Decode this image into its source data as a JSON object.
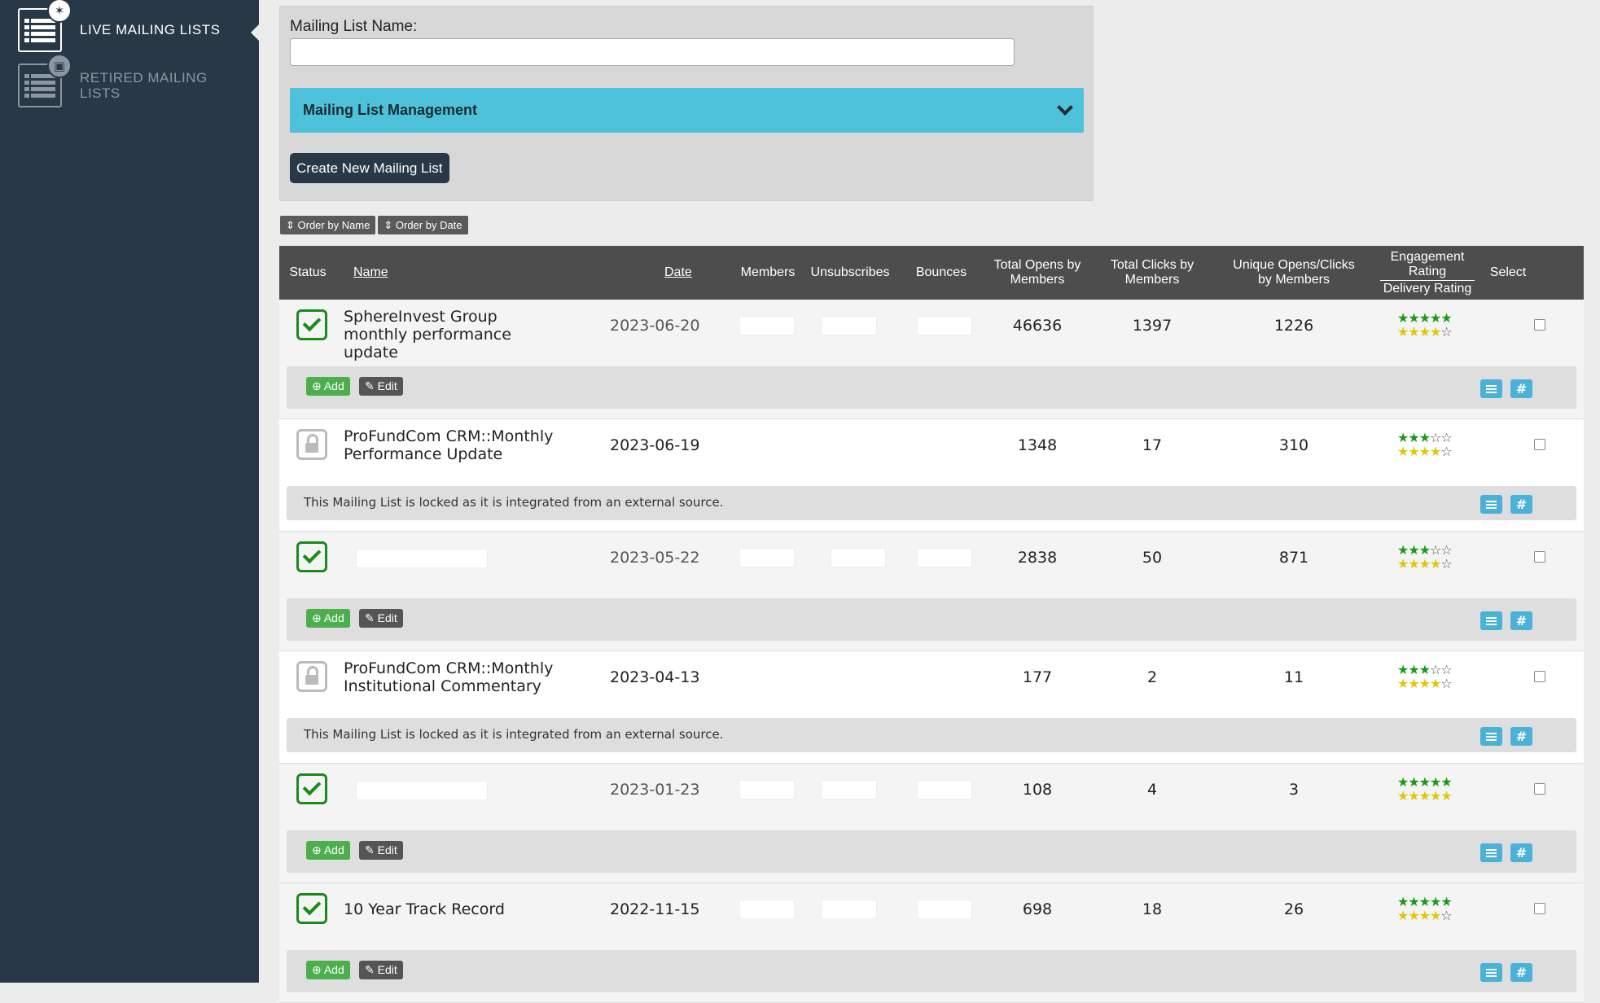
{
  "sidebar": {
    "items": [
      {
        "label": "LIVE MAILING LISTS",
        "icon": "list-icon",
        "badge": "person-icon"
      },
      {
        "label": "RETIRED MAILING LISTS",
        "icon": "list-icon",
        "badge": "bed-icon"
      }
    ]
  },
  "form": {
    "name_label": "Mailing List Name:",
    "name_value": "",
    "mgmt_title": "Mailing List Management",
    "create_label": "Create New Mailing List"
  },
  "order": {
    "by_name": "⇕ Order by Name",
    "by_date": "⇕ Order by Date"
  },
  "table": {
    "headers": {
      "status": "Status",
      "name": "Name",
      "date": "Date",
      "members": "Members",
      "unsubscribes": "Unsubscribes",
      "bounces": "Bounces",
      "total_opens_1": "Total Opens by",
      "total_opens_2": "Members",
      "total_clicks_1": "Total Clicks by",
      "total_clicks_2": "Members",
      "unique_1": "Unique Opens/Clicks",
      "unique_2": "by Members",
      "engagement_1": "Engagement",
      "engagement_2": "Rating",
      "delivery": "Delivery Rating",
      "select": "Select"
    },
    "rows": [
      {
        "status": "active",
        "name": "SphereInvest Group monthly performance update",
        "date": "2023-06-20",
        "opens": "46636",
        "clicks": "1397",
        "unique": "1226",
        "engagement": 5,
        "delivery": 4
      },
      {
        "status": "locked",
        "name": "ProFundCom CRM::Monthly Performance Update",
        "date": "2023-06-19",
        "opens": "1348",
        "clicks": "17",
        "unique": "310",
        "engagement": 3,
        "delivery": 4
      },
      {
        "status": "active",
        "name": "",
        "date": "2023-05-22",
        "opens": "2838",
        "clicks": "50",
        "unique": "871",
        "engagement": 3,
        "delivery": 4
      },
      {
        "status": "locked",
        "name": "ProFundCom CRM::Monthly Institutional Commentary",
        "date": "2023-04-13",
        "opens": "177",
        "clicks": "2",
        "unique": "11",
        "engagement": 3,
        "delivery": 4
      },
      {
        "status": "active",
        "name": "",
        "date": "2023-01-23",
        "opens": "108",
        "clicks": "4",
        "unique": "3",
        "engagement": 5,
        "delivery": 5
      },
      {
        "status": "active",
        "name": "10 Year Track Record",
        "date": "2022-11-15",
        "opens": "698",
        "clicks": "18",
        "unique": "26",
        "engagement": 5,
        "delivery": 4
      }
    ],
    "locked_message": "This Mailing List is locked as it is integrated from an external source.",
    "add_label": "⊕ Add",
    "edit_label": "✎ Edit",
    "hash_label": "#"
  },
  "colors": {
    "sidebar": "#283847",
    "accent": "#4ec2da",
    "engagement_star": "#1a9a1a",
    "delivery_star": "#e0c70a",
    "add": "#4cae4c"
  }
}
